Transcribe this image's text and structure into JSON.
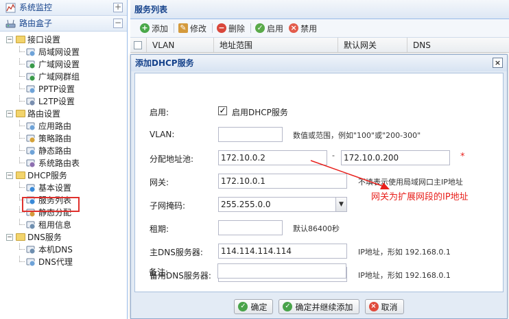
{
  "sidebar": {
    "header1": "系统监控",
    "header2": "路由盒子",
    "tree": [
      {
        "label": "接口设置",
        "level": 0
      },
      {
        "label": "局域网设置",
        "level": 1
      },
      {
        "label": "广域网设置",
        "level": 1
      },
      {
        "label": "广域网群组",
        "level": 1
      },
      {
        "label": "PPTP设置",
        "level": 1
      },
      {
        "label": "L2TP设置",
        "level": 1
      },
      {
        "label": "路由设置",
        "level": 0
      },
      {
        "label": "应用路由",
        "level": 1
      },
      {
        "label": "策略路由",
        "level": 1
      },
      {
        "label": "静态路由",
        "level": 1
      },
      {
        "label": "系统路由表",
        "level": 1
      },
      {
        "label": "DHCP服务",
        "level": 0
      },
      {
        "label": "基本设置",
        "level": 1
      },
      {
        "label": "服务列表",
        "level": 1
      },
      {
        "label": "静态分配",
        "level": 1
      },
      {
        "label": "租用信息",
        "level": 1
      },
      {
        "label": "DNS服务",
        "level": 0
      },
      {
        "label": "本机DNS",
        "level": 1
      },
      {
        "label": "DNS代理",
        "level": 1
      }
    ]
  },
  "main": {
    "title": "服务列表",
    "toolbar": {
      "add": "添加",
      "edit": "修改",
      "delete": "删除",
      "enable": "启用",
      "disable": "禁用"
    },
    "columns": [
      "VLAN",
      "地址范围",
      "默认网关",
      "DNS"
    ]
  },
  "dialog": {
    "title": "添加DHCP服务",
    "enable_label": "启用:",
    "enable_checkbox_label": "启用DHCP服务",
    "enable_checked_mark": "✓",
    "vlan_label": "VLAN:",
    "vlan_value": "",
    "vlan_hint": "数值或范围，例如\"100\"或\"200-300\"",
    "pool_label": "分配地址池:",
    "pool_start": "172.10.0.2",
    "pool_dash": "-",
    "pool_end": "172.10.0.200",
    "required_mark": "*",
    "gateway_label": "网关:",
    "gateway_value": "172.10.0.1",
    "gateway_hint": "不填表示使用局域网口主IP地址",
    "mask_label": "子网掩码:",
    "mask_value": "255.255.0.0",
    "lease_label": "租期:",
    "lease_value": "",
    "lease_hint": "默认86400秒",
    "dns1_label": "主DNS服务器:",
    "dns1_value": "114.114.114.114",
    "dns1_hint": "IP地址，形如 192.168.0.1",
    "dns2_label": "备用DNS服务器:",
    "dns2_value": "",
    "dns2_hint": "IP地址，形如 192.168.0.1",
    "note_label": "备注:",
    "note_value": "",
    "buttons": {
      "ok": "确定",
      "ok_continue": "确定并继续添加",
      "cancel": "取消"
    }
  },
  "annotation": {
    "text": "网关为扩展网段的IP地址",
    "color": "#e8201c"
  },
  "colors": {
    "accent": "#15428b",
    "border": "#99bbe8",
    "highlight_box": "#e0302c"
  }
}
